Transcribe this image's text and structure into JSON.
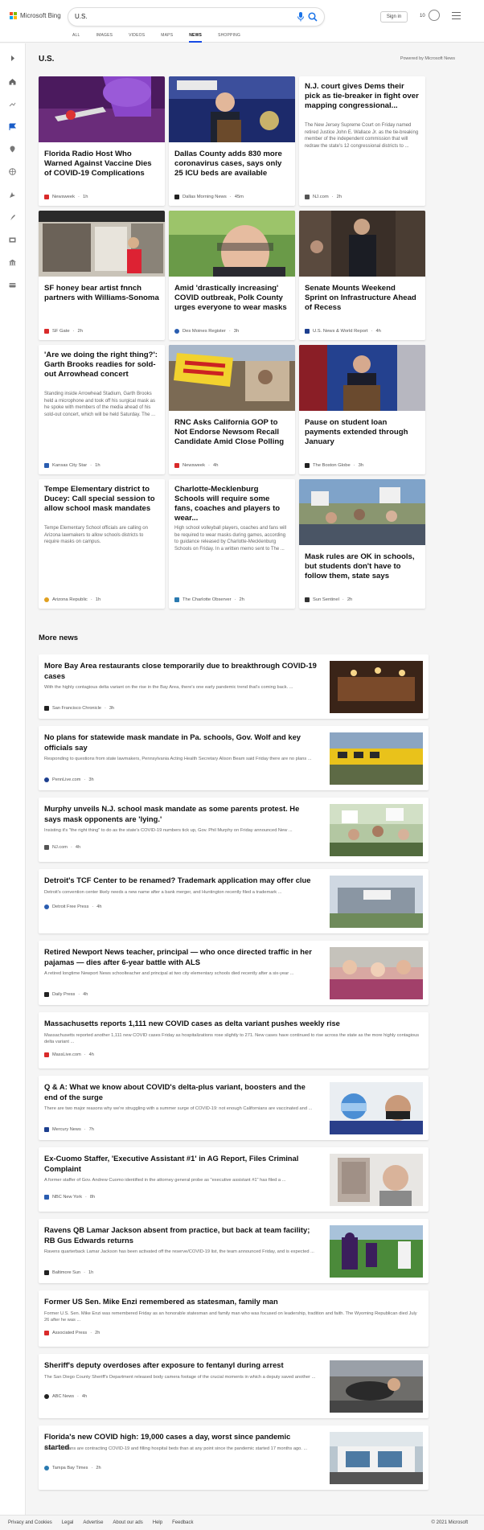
{
  "header": {
    "logo_text": "Microsoft Bing",
    "search_value": "U.S.",
    "signin": "Sign in",
    "points": "10"
  },
  "tabs": [
    {
      "label": "ALL"
    },
    {
      "label": "IMAGES"
    },
    {
      "label": "VIDEOS"
    },
    {
      "label": "MAPS"
    },
    {
      "label": "NEWS"
    },
    {
      "label": "SHOPPING"
    }
  ],
  "section": {
    "title": "U.S.",
    "powered": "Powered by Microsoft News",
    "more_title": "More news"
  },
  "cards": [
    {
      "title": "Florida Radio Host Who Warned Against Vaccine Dies of COVID-19 Complications",
      "source": "Newsweek",
      "time": "1h",
      "color": "#d92a2a"
    },
    {
      "title": "Dallas County adds 830 more coronavirus cases, says only 25 ICU beds are available",
      "source": "Dallas Morning News",
      "time": "45m",
      "color": "#222"
    },
    {
      "title": "N.J. court gives Dems their pick as tie-breaker in fight over mapping congressional...",
      "snippet": "The New Jersey Supreme Court on Friday named retired Justice John E. Wallace Jr. as the tie-breaking member of the independent commission that will redraw the state's 12 congressional districts to ...",
      "source": "NJ.com",
      "time": "2h",
      "color": "#555"
    },
    {
      "title": "SF honey bear artist fnnch partners with Williams-Sonoma",
      "source": "SF Gate",
      "time": "2h",
      "color": "#d92a2a"
    },
    {
      "title": "Amid 'drastically increasing' COVID outbreak, Polk County urges everyone to wear masks",
      "source": "Des Moines Register",
      "time": "3h",
      "color": "#2a5db0"
    },
    {
      "title": "Senate Mounts Weekend Sprint on Infrastructure Ahead of Recess",
      "source": "U.S. News & World Report",
      "time": "4h",
      "color": "#1d3f8f"
    },
    {
      "title": "'Are we doing the right thing?': Garth Brooks readies for sold-out Arrowhead concert",
      "snippet": "Standing inside Arrowhead Stadium, Garth Brooks held a microphone and took off his surgical mask as he spoke with members of the media ahead of his sold-out concert, which will be held Saturday. The ...",
      "source": "Kansas City Star",
      "time": "1h",
      "color": "#2a5db0"
    },
    {
      "title": "RNC Asks California GOP to Not Endorse Newsom Recall Candidate Amid Close Polling",
      "source": "Newsweek",
      "time": "4h",
      "color": "#d92a2a"
    },
    {
      "title": "Pause on student loan payments extended through January",
      "source": "The Boston Globe",
      "time": "3h",
      "color": "#222"
    },
    {
      "title": "Tempe Elementary district to Ducey: Call special session to allow school mask mandates",
      "snippet": "Tempe Elementary School officials are calling on Arizona lawmakers to allow schools districts to require masks on campus.",
      "source": "Arizona Republic",
      "time": "1h",
      "color": "#e0a020"
    },
    {
      "title": "Charlotte-Mecklenburg Schools will require some fans, coaches and players to wear...",
      "snippet": "High school volleyball players, coaches and fans will be required to wear masks during games, according to guidance released by Charlotte-Mecklenburg Schools on Friday. In a written memo sent to The ...",
      "source": "The Charlotte Observer",
      "time": "2h",
      "color": "#2a7ab0"
    },
    {
      "title": "Mask rules are OK in schools, but students don't have to follow them, state says",
      "source": "Sun Sentinel",
      "time": "2h",
      "color": "#333"
    }
  ],
  "more": [
    {
      "title": "More Bay Area restaurants close temporarily due to breakthrough COVID-19 cases",
      "snippet": "With the highly contagious delta variant on the rise in the Bay Area, there's one early pandemic trend that's coming back. ...",
      "source": "San Francisco Chronicle",
      "time": "3h",
      "color": "#222"
    },
    {
      "title": "No plans for statewide mask mandate in Pa. schools, Gov. Wolf and key officials say",
      "snippet": "Responding to questions from state lawmakers, Pennsylvania Acting Health Secretary Alison Beam said Friday there are no plans ...",
      "source": "PennLive.com",
      "time": "3h",
      "color": "#1d3f8f"
    },
    {
      "title": "Murphy unveils N.J. school mask mandate as some parents protest. He says mask opponents are 'lying.'",
      "snippet": "Insisting it's \"the right thing\" to do as the state's COVID-19 numbers tick up, Gov. Phil Murphy on Friday announced New ...",
      "source": "NJ.com",
      "time": "4h",
      "color": "#555"
    },
    {
      "title": "Detroit's TCF Center to be renamed? Trademark application may offer clue",
      "snippet": "Detroit's convention center likely needs a new name after a bank merger, and Huntington recently filed a trademark ...",
      "source": "Detroit Free Press",
      "time": "4h",
      "color": "#2a5db0"
    },
    {
      "title": "Retired Newport News teacher, principal — who once directed traffic in her pajamas — dies after 6-year battle with ALS",
      "snippet": "A retired longtime Newport News schoolteacher and principal at two city elementary schools died recently after a six-year ...",
      "source": "Daily Press",
      "time": "4h",
      "color": "#222"
    },
    {
      "title": "Massachusetts reports 1,111 new COVID cases as delta variant pushes weekly rise",
      "snippet": "Massachusetts reported another 1,111 new COVID cases Friday as hospitalizations rose slightly to 271. New cases have continued to rise across the state as the more highly contagious delta variant ...",
      "source": "MassLive.com",
      "time": "4h",
      "color": "#d92a2a"
    },
    {
      "title": "Q & A: What we know about COVID's delta-plus variant, boosters and the end of the surge",
      "snippet": "There are two major reasons why we're struggling with a summer surge of COVID-19: not enough Californians are vaccinated and ...",
      "source": "Mercury News",
      "time": "7h",
      "color": "#1d3f8f"
    },
    {
      "title": "Ex-Cuomo Staffer, 'Executive Assistant #1' in AG Report, Files Criminal Complaint",
      "snippet": "A former staffer of Gov. Andrew Cuomo identified in the attorney general probe as \"executive assistant #1\" has filed a ...",
      "source": "NBC New York",
      "time": "8h",
      "color": "#2a5db0"
    },
    {
      "title": "Ravens QB Lamar Jackson absent from practice, but back at team facility; RB Gus Edwards returns",
      "snippet": "Ravens quarterback Lamar Jackson has been activated off the reserve/COVID-19 list, the team announced Friday, and is expected ...",
      "source": "Baltimore Sun",
      "time": "1h",
      "color": "#222"
    },
    {
      "title": "Former US Sen. Mike Enzi remembered as statesman, family man",
      "snippet": "Former U.S. Sen. Mike Enzi was remembered Friday as an honorable statesman and family man who was focused on leadership, tradition and faith. The Wyoming Republican died July 26 after he was ...",
      "source": "Associated Press",
      "time": "2h",
      "color": "#d92a2a"
    },
    {
      "title": "Sheriff's deputy overdoses after exposure to fentanyl during arrest",
      "snippet": "The San Diego County Sheriff's Department released body camera footage of the crucial moments in which a deputy saved another ...",
      "source": "ABC News",
      "time": "4h",
      "color": "#222"
    },
    {
      "title": "Florida's new COVID high: 19,000 cases a day, worst since pandemic started",
      "snippet": "More Floridians are contracting COVID-19 and filling hospital beds than at any point since the pandemic started 17 months ago. ...",
      "source": "Tampa Bay Times",
      "time": "2h",
      "color": "#2a7ab0"
    }
  ],
  "footer": {
    "links": [
      "Privacy and Cookies",
      "Legal",
      "Advertise",
      "About our ads",
      "Help",
      "Feedback"
    ],
    "copyright": "© 2021 Microsoft"
  }
}
